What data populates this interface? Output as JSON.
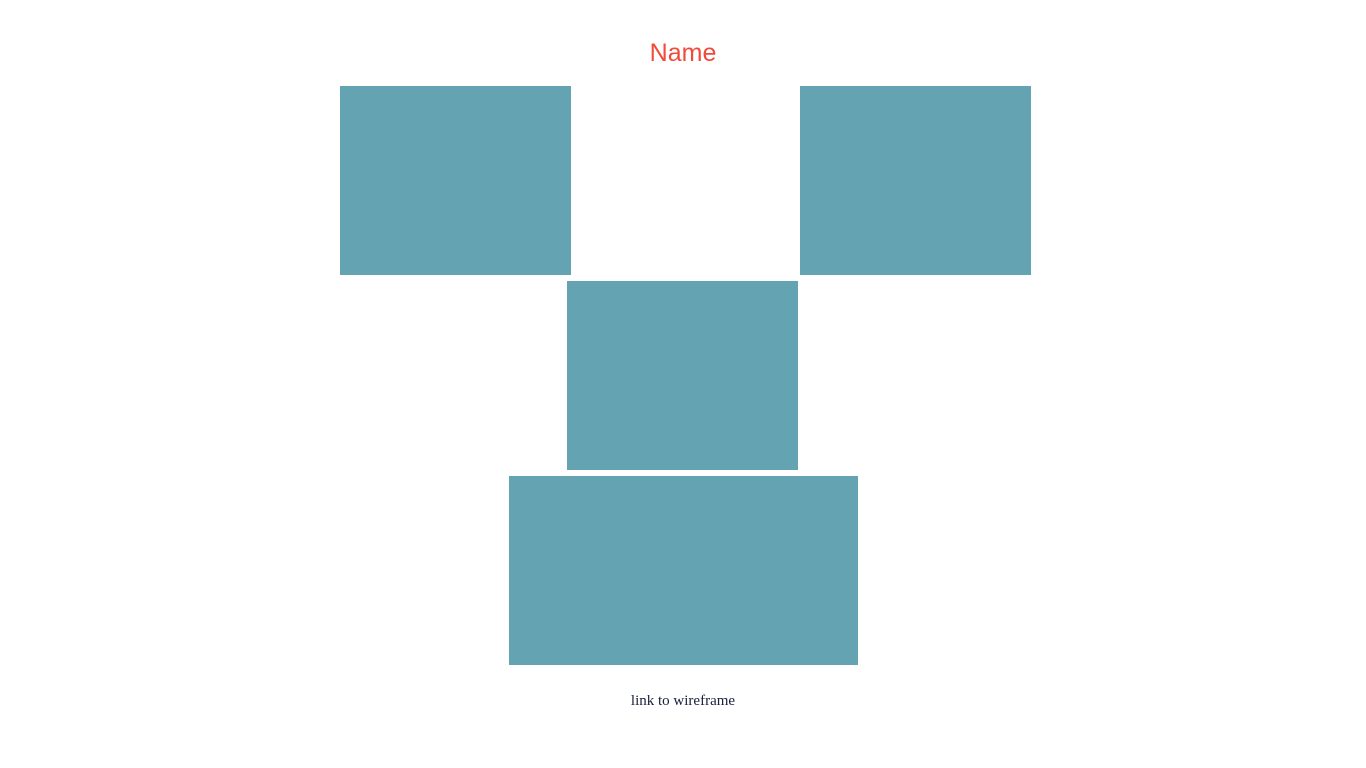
{
  "header": {
    "title": "Name",
    "title_color": "#f04a38"
  },
  "gallery": {
    "tile_color": "#64a4b2",
    "tile_count": 4
  },
  "footer": {
    "link_text": "link to wireframe",
    "link_color": "#1a1f3d"
  }
}
